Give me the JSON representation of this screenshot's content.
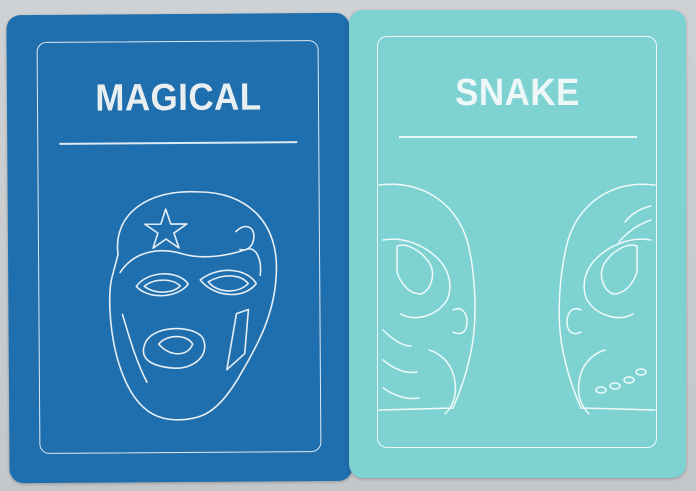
{
  "cards": [
    {
      "title": "MAGICAL",
      "background": "#1f6fae",
      "line_color": "#e6eef5",
      "icon": "wrestler-mask-star-icon"
    },
    {
      "title": "SNAKE",
      "background": "#7fd2d2",
      "line_color": "#f1fbfb",
      "icon": "wrestler-mask-split-icon"
    }
  ],
  "colors": {
    "table": "#c8cbcd"
  }
}
